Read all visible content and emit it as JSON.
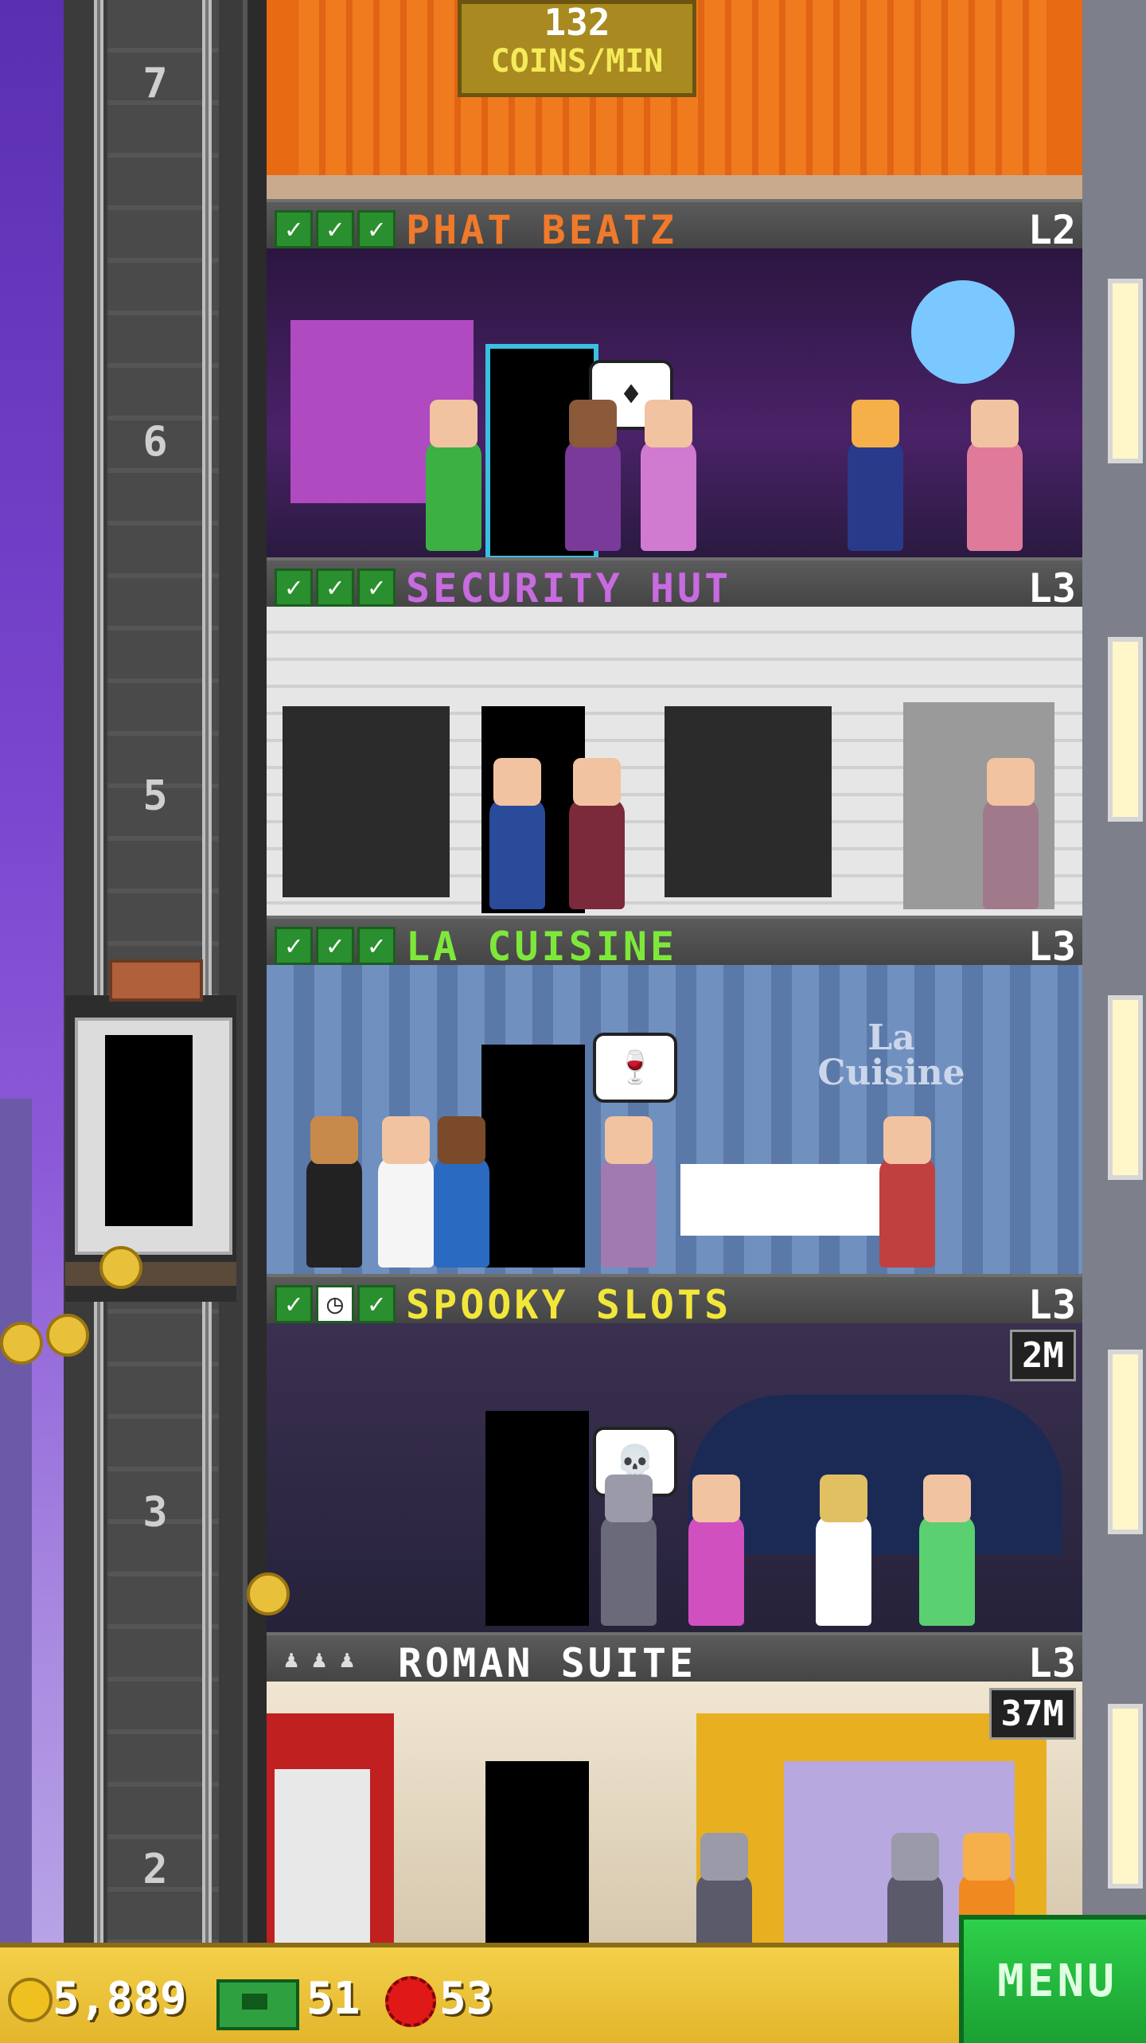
{
  "top_floor": {
    "coins": "132",
    "unit": "COINS/MIN"
  },
  "floor_numbers": [
    "7",
    "6",
    "5",
    "3",
    "2"
  ],
  "floors": [
    {
      "name": "PHAT BEATZ",
      "level": "L2",
      "name_color": "#f07a2a",
      "status": [
        "check",
        "check",
        "check"
      ],
      "scene_color": "#3a1f55",
      "timer": ""
    },
    {
      "name": "SECURITY HUT",
      "level": "L3",
      "name_color": "#c86be0",
      "status": [
        "check",
        "check",
        "check"
      ],
      "scene_color": "#d8d8d8",
      "timer": ""
    },
    {
      "name": "LA CUISINE",
      "level": "L3",
      "name_color": "#7ee83a",
      "status": [
        "check",
        "check",
        "check"
      ],
      "scene_color": "#6b85b0",
      "timer": "",
      "sign": "La Cuisine"
    },
    {
      "name": "SPOOKY SLOTS",
      "level": "L3",
      "name_color": "#f2e63a",
      "status": [
        "check",
        "clock",
        "check"
      ],
      "scene_color": "#2b2846",
      "timer": "2M"
    },
    {
      "name": "ROMAN SUITE",
      "level": "L3",
      "name_color": "#ffffff",
      "status": [
        "person",
        "person",
        "person"
      ],
      "scene_color": "#e8dcc8",
      "timer": "37M"
    }
  ],
  "bottom_bar": {
    "coins": "5,889",
    "bux": "51",
    "gems": "53",
    "menu_label": "MENU",
    "icons": {
      "coins": "coin-icon",
      "bux": "tower-bux-icon",
      "gems": "gem-icon"
    }
  },
  "bubbles": [
    "♦",
    "🍷",
    "💀"
  ]
}
